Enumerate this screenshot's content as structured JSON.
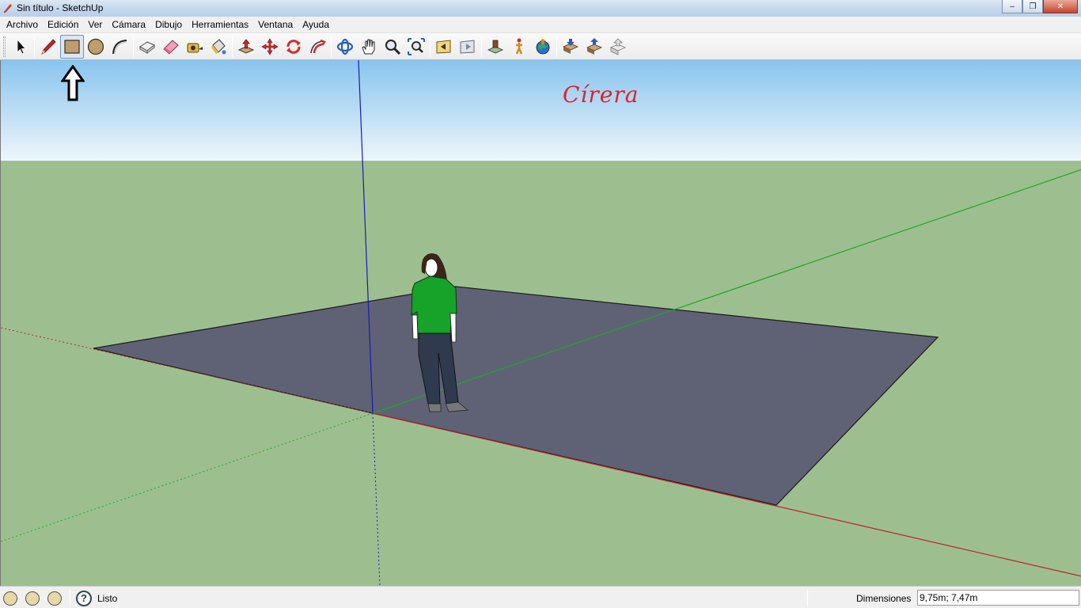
{
  "window": {
    "title": "Sin título - SketchUp",
    "minimize_glyph": "–",
    "restore_glyph": "❐",
    "close_glyph": "✕"
  },
  "menu": {
    "items": [
      "Archivo",
      "Edición",
      "Ver",
      "Cámara",
      "Dibujo",
      "Herramientas",
      "Ventana",
      "Ayuda"
    ]
  },
  "toolbar": {
    "tools": [
      {
        "name": "select-tool-icon",
        "active": false
      },
      {
        "name": "line-tool-icon",
        "active": false
      },
      {
        "name": "rectangle-tool-icon",
        "active": true
      },
      {
        "name": "circle-tool-icon",
        "active": false
      },
      {
        "name": "arc-tool-icon",
        "active": false
      },
      {
        "name": "make-component-icon",
        "active": false
      },
      {
        "name": "eraser-tool-icon",
        "active": false
      },
      {
        "name": "tape-measure-icon",
        "active": false
      },
      {
        "name": "paint-bucket-icon",
        "active": false
      },
      {
        "name": "push-pull-icon",
        "active": false
      },
      {
        "name": "move-tool-icon",
        "active": false
      },
      {
        "name": "rotate-tool-icon",
        "active": false
      },
      {
        "name": "follow-me-icon",
        "active": false
      },
      {
        "name": "orbit-tool-icon",
        "active": false
      },
      {
        "name": "pan-tool-icon",
        "active": false
      },
      {
        "name": "zoom-tool-icon",
        "active": false
      },
      {
        "name": "zoom-extents-icon",
        "active": false
      },
      {
        "name": "previous-view-icon",
        "active": false
      },
      {
        "name": "next-view-icon",
        "active": false
      },
      {
        "name": "position-camera-icon",
        "active": false
      },
      {
        "name": "walk-tool-icon",
        "active": false
      },
      {
        "name": "google-earth-icon",
        "active": false
      },
      {
        "name": "get-models-icon",
        "active": false
      },
      {
        "name": "share-model-icon",
        "active": false
      },
      {
        "name": "share-component-icon",
        "active": false
      }
    ]
  },
  "viewport": {
    "annotation_text": "Círera",
    "colors": {
      "sky_top": "#88c4ee",
      "sky_bottom": "#eef6fb",
      "ground": "#9dbf8f",
      "face": "#5f6275",
      "axis_red": "#c0202a",
      "axis_green": "#1ca82a",
      "axis_blue": "#1a1ab8",
      "annotation": "#e0202a"
    }
  },
  "status": {
    "text": "Listo",
    "help_glyph": "?",
    "dimension_label": "Dimensiones",
    "dimension_value": "9,75m; 7,47m"
  }
}
